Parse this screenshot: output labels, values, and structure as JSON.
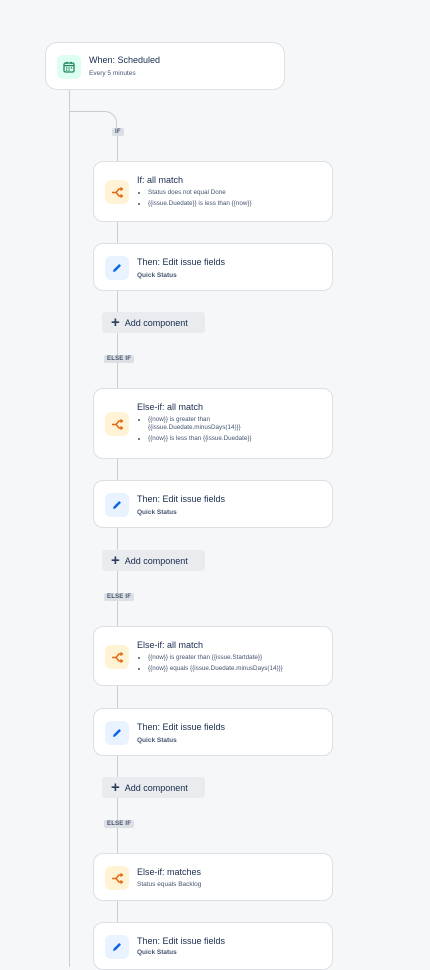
{
  "trigger": {
    "title": "When: Scheduled",
    "subtitle": "Every 5 minutes",
    "icon": "calendar-icon"
  },
  "branches": [
    {
      "label": "IF",
      "condition": {
        "title": "If: all match",
        "items": [
          "Status does not equal Done",
          "{{issue.Duedate}} is less than {{now}}"
        ]
      },
      "action": {
        "title": "Then: Edit issue fields",
        "subtitle": "Quick Status"
      },
      "add_label": "Add component"
    },
    {
      "label": "ELSE IF",
      "condition": {
        "title": "Else-if: all match",
        "items": [
          "{{now}} is greater than {{issue.Duedate.minusDays(14)}}",
          "{{now}} is less than {{issue.Duedate}}"
        ]
      },
      "action": {
        "title": "Then: Edit issue fields",
        "subtitle": "Quick Status"
      },
      "add_label": "Add component"
    },
    {
      "label": "ELSE IF",
      "condition": {
        "title": "Else-if: all match",
        "items": [
          "{{now}} is greater than {{issue.Startdate}}",
          "{{now}} equals {{issue.Duedate.minusDays(14)}}"
        ]
      },
      "action": {
        "title": "Then: Edit issue fields",
        "subtitle": "Quick Status"
      },
      "add_label": "Add component"
    },
    {
      "label": "ELSE IF",
      "condition": {
        "title": "Else-if: matches",
        "subtitle": "Status equals Backlog"
      },
      "action": {
        "title": "Then: Edit issue fields",
        "subtitle": "Quick Status"
      }
    }
  ],
  "colors": {
    "trigger_icon": "#1f845a",
    "condition_icon": "#e56910",
    "action_icon": "#0c66e4"
  }
}
